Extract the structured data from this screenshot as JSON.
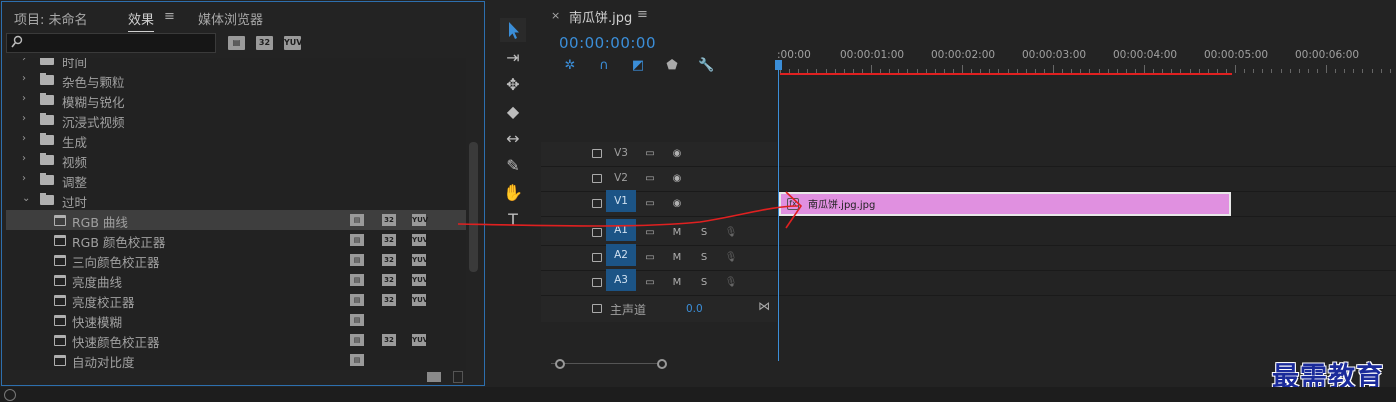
{
  "left_panel": {
    "tabs": [
      {
        "label": "项目: 未命名"
      },
      {
        "label": "效果"
      },
      {
        "label": "≡"
      },
      {
        "label": "媒体浏览器"
      }
    ],
    "badges": [
      "32",
      "YUV"
    ],
    "rows": [
      {
        "label": "时间",
        "type": "folder"
      },
      {
        "label": "杂色与颗粒",
        "type": "folder"
      },
      {
        "label": "模糊与锐化",
        "type": "folder"
      },
      {
        "label": "沉浸式视频",
        "type": "folder"
      },
      {
        "label": "生成",
        "type": "folder"
      },
      {
        "label": "视频",
        "type": "folder"
      },
      {
        "label": "调整",
        "type": "folder"
      },
      {
        "label": "过时",
        "type": "folder-open"
      },
      {
        "label": "RGB 曲线",
        "type": "effect",
        "selected": true
      },
      {
        "label": "RGB 颜色校正器",
        "type": "effect"
      },
      {
        "label": "三向颜色校正器",
        "type": "effect"
      },
      {
        "label": "亮度曲线",
        "type": "effect"
      },
      {
        "label": "亮度校正器",
        "type": "effect"
      },
      {
        "label": "快速模糊",
        "type": "effect"
      },
      {
        "label": "快速颜色校正器",
        "type": "effect"
      },
      {
        "label": "自动对比度",
        "type": "effect"
      }
    ]
  },
  "sequence": {
    "close": "×",
    "tab_title": "南瓜饼.jpg",
    "menu": "≡",
    "timecode": "00:00:00:00",
    "ruler_ticks": [
      ":00:00",
      "00:00:01:00",
      "00:00:02:00",
      "00:00:03:00",
      "00:00:04:00",
      "00:00:05:00",
      "00:00:06:00"
    ],
    "tracks": [
      {
        "label": "V3",
        "kind": "video"
      },
      {
        "label": "V2",
        "kind": "video"
      },
      {
        "label": "V1",
        "kind": "video",
        "targeted": true
      },
      {
        "label": "A1",
        "kind": "audio",
        "targeted": true
      },
      {
        "label": "A2",
        "kind": "audio",
        "targeted": true
      },
      {
        "label": "A3",
        "kind": "audio",
        "targeted": true
      }
    ],
    "audio_buttons": {
      "mute": "M",
      "solo": "S"
    },
    "master": {
      "label": "主声道",
      "value": "0.0"
    },
    "clip": {
      "name": "南瓜饼.jpg.jpg",
      "color": "#e090e0"
    }
  },
  "watermark": "最需教育",
  "colors": {
    "accent": "#3b8ed8",
    "track_target": "#1c5486",
    "arrow": "#e02020"
  }
}
